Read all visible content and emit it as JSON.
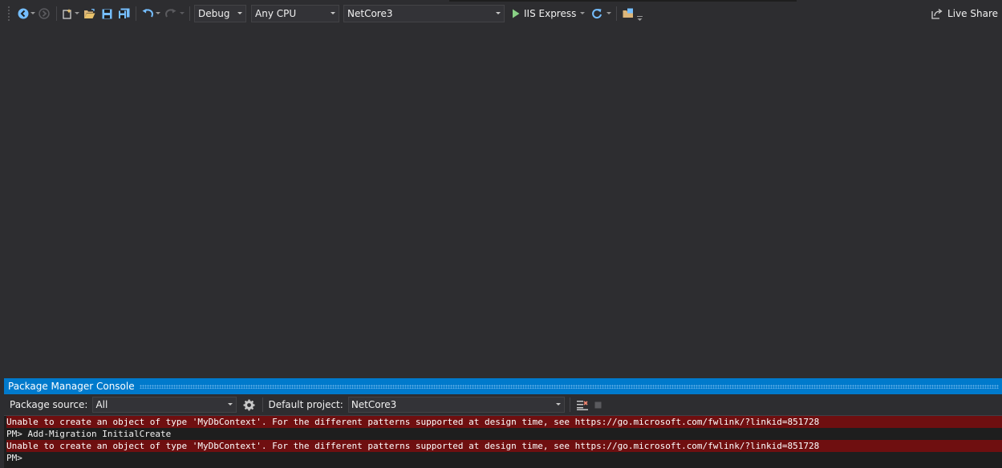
{
  "toolbar": {
    "configuration": "Debug",
    "platform": "Any CPU",
    "startup_project": "NetCore3",
    "run_target": "IIS Express",
    "live_share": "Live Share"
  },
  "pmc": {
    "title": "Package Manager Console",
    "package_source_label": "Package source:",
    "package_source_value": "All",
    "default_project_label": "Default project:",
    "default_project_value": "NetCore3",
    "lines": [
      {
        "text": "Unable to create an object of type 'MyDbContext'. For the different patterns supported at design time, see https://go.microsoft.com/fwlink/?linkid=851728",
        "type": "error"
      },
      {
        "text": "PM> Add-Migration InitialCreate",
        "type": "normal"
      },
      {
        "text": "Unable to create an object of type 'MyDbContext'. For the different patterns supported at design time, see https://go.microsoft.com/fwlink/?linkid=851728",
        "type": "error"
      },
      {
        "text": "PM>",
        "type": "normal"
      }
    ]
  },
  "colors": {
    "accent": "#007acc",
    "error_bg": "#6f0f10",
    "run_green": "#89d185",
    "icon_blue": "#75beff"
  }
}
